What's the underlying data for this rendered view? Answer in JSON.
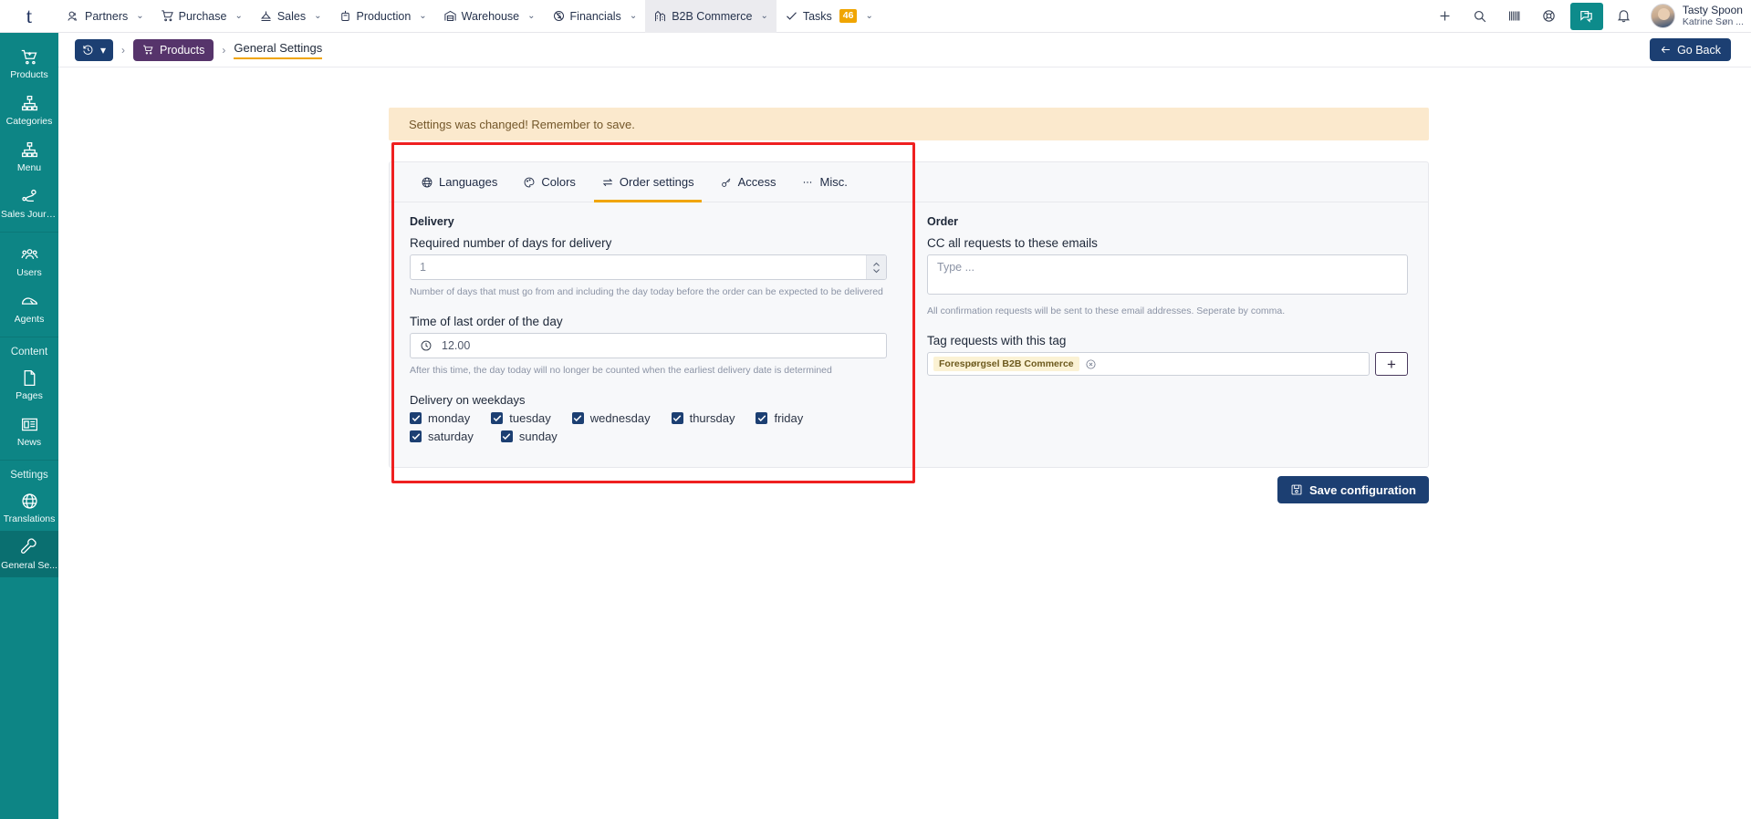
{
  "topnav": {
    "logo": "t",
    "items": [
      {
        "label": "Partners",
        "icon": "partners-icon",
        "caret": true,
        "active": false
      },
      {
        "label": "Purchase",
        "icon": "cart-icon",
        "caret": true,
        "active": false
      },
      {
        "label": "Sales",
        "icon": "sales-icon",
        "caret": true,
        "active": false
      },
      {
        "label": "Production",
        "icon": "production-icon",
        "caret": true,
        "active": false
      },
      {
        "label": "Warehouse",
        "icon": "warehouse-icon",
        "caret": true,
        "active": false
      },
      {
        "label": "Financials",
        "icon": "financials-icon",
        "caret": true,
        "active": false
      },
      {
        "label": "B2B Commerce",
        "icon": "b2b-icon",
        "caret": true,
        "active": true
      },
      {
        "label": "Tasks",
        "icon": "check-icon",
        "caret": true,
        "active": false,
        "badge": "46"
      }
    ],
    "actions": [
      {
        "name": "add-icon",
        "glyph": "plus"
      },
      {
        "name": "search-icon",
        "glyph": "search"
      },
      {
        "name": "barcode-icon",
        "glyph": "barcode"
      },
      {
        "name": "lifebuoy-icon",
        "glyph": "lifebuoy"
      },
      {
        "name": "chat-icon",
        "glyph": "chat",
        "highlight": true
      },
      {
        "name": "bell-icon",
        "glyph": "bell"
      }
    ],
    "user": {
      "name": "Tasty Spoon",
      "subtitle": "Katrine Søn ..."
    }
  },
  "sidebar": {
    "items": [
      {
        "label": "Products",
        "icon": "cart-plus-icon",
        "active": false
      },
      {
        "label": "Categories",
        "icon": "sitemap-icon",
        "active": false
      },
      {
        "label": "Menu",
        "icon": "sitemap-icon",
        "active": false
      },
      {
        "label": "Sales Journ...",
        "icon": "route-icon",
        "active": false
      }
    ],
    "items2": [
      {
        "label": "Users",
        "icon": "users-icon",
        "active": false
      },
      {
        "label": "Agents",
        "icon": "agent-icon",
        "active": false
      }
    ],
    "group_content": "Content",
    "items3": [
      {
        "label": "Pages",
        "icon": "page-icon",
        "active": false
      },
      {
        "label": "News",
        "icon": "news-icon",
        "active": false
      }
    ],
    "group_settings": "Settings",
    "items4": [
      {
        "label": "Translations",
        "icon": "globe-icon",
        "active": false
      },
      {
        "label": "General Se...",
        "icon": "wrench-icon",
        "active": true
      }
    ]
  },
  "breadcrumb": {
    "history_icon": "history-icon",
    "history_caret": "▾",
    "separator": "›",
    "products": "Products",
    "current": "General Settings",
    "go_back": "Go Back"
  },
  "alert": {
    "message": "Settings was changed! Remember to save."
  },
  "tabs": [
    {
      "label": "Languages",
      "icon": "globe-icon",
      "active": false
    },
    {
      "label": "Colors",
      "icon": "palette-icon",
      "active": false
    },
    {
      "label": "Order settings",
      "icon": "exchange-icon",
      "active": true
    },
    {
      "label": "Access",
      "icon": "key-icon",
      "active": false
    },
    {
      "label": "Misc.",
      "icon": "ellipsis-icon",
      "active": false
    }
  ],
  "delivery": {
    "section_title": "Delivery",
    "days_label": "Required number of days for delivery",
    "days_value": "",
    "days_placeholder": "1",
    "days_help": "Number of days that must go from and including the day today before the order can be expected to be delivered",
    "time_label": "Time of last order of the day",
    "time_value": "12.00",
    "time_icon": "clock-icon",
    "time_help": "After this time, the day today will no longer be counted when the earliest delivery date is determined",
    "weekdays_label": "Delivery on weekdays",
    "weekdays": [
      {
        "label": "monday",
        "checked": true
      },
      {
        "label": "tuesday",
        "checked": true
      },
      {
        "label": "wednesday",
        "checked": true
      },
      {
        "label": "thursday",
        "checked": true
      },
      {
        "label": "friday",
        "checked": true
      },
      {
        "label": "saturday",
        "checked": true
      },
      {
        "label": "sunday",
        "checked": true
      }
    ]
  },
  "order": {
    "section_title": "Order",
    "cc_label": "CC all requests to these emails",
    "cc_value": "",
    "cc_placeholder": "Type ...",
    "cc_help": "All confirmation requests will be sent to these email addresses. Seperate by comma.",
    "tag_label": "Tag requests with this tag",
    "tag_chip": "Forespørgsel B2B Commerce",
    "tag_remove_icon": "circle-x-icon",
    "tag_add": "+"
  },
  "footer": {
    "save_label": "Save configuration",
    "save_icon": "save-icon"
  },
  "colors": {
    "teal": "#0d8585",
    "navy": "#1c3f72",
    "purple": "#56346b",
    "amber": "#f0a500",
    "alert_bg": "#fbe9cd",
    "annotation": "#ef2020"
  }
}
